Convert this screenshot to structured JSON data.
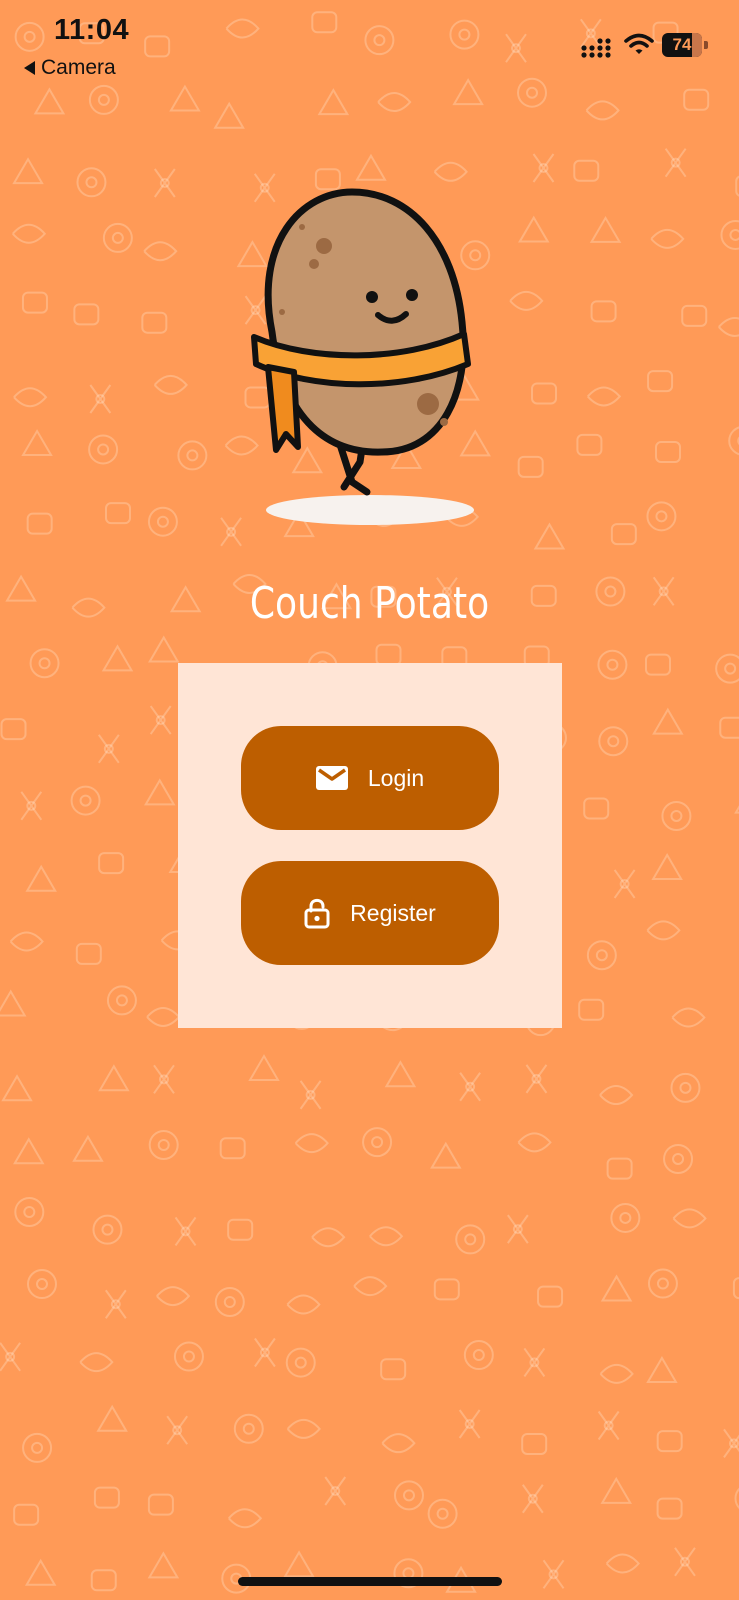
{
  "status_bar": {
    "time": "11:04",
    "back_label": "Camera",
    "battery_level": "74",
    "icons": [
      "signal-icon",
      "wifi-icon",
      "battery-icon"
    ]
  },
  "app": {
    "title": "Couch Potato",
    "mascot": "potato-mascot"
  },
  "buttons": {
    "login_label": "Login",
    "login_icon": "mail-icon",
    "register_label": "Register",
    "register_icon": "lock-icon"
  },
  "colors": {
    "background": "#FF9A57",
    "panel": "#FFE5D6",
    "button": "#BD5E00",
    "title": "#FFFFFF"
  }
}
